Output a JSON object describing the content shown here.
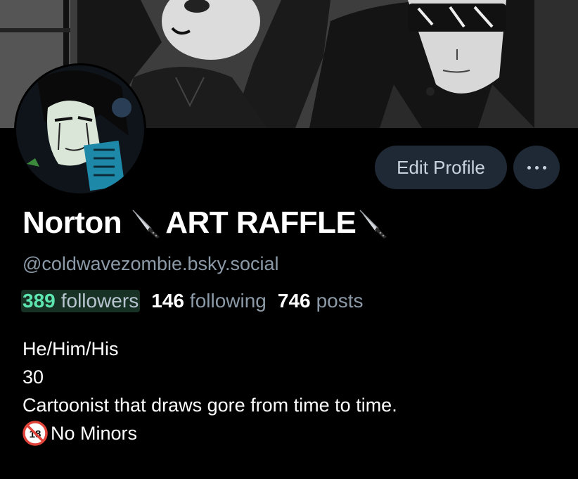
{
  "profile": {
    "display_name_part1": "Norton",
    "display_name_part2": "ART RAFFLE",
    "name_icon": "kitchen-knife-icon",
    "handle": "@coldwavezombie.bsky.social",
    "edit_label": "Edit Profile",
    "more_icon": "ellipsis-icon"
  },
  "stats": {
    "followers_count": "389",
    "followers_label": "followers",
    "following_count": "146",
    "following_label": "following",
    "posts_count": "746",
    "posts_label": "posts"
  },
  "bio": {
    "line1": "He/Him/His",
    "line2": "30",
    "line3": "Cartoonist that draws gore from time to time.",
    "line4_icon": "no-one-under-eighteen-icon",
    "line4_text": "No Minors"
  },
  "colors": {
    "background": "#000000",
    "button_bg": "#1e2935",
    "secondary_text": "#8c9aa8",
    "highlight": "#5ee6b0"
  }
}
